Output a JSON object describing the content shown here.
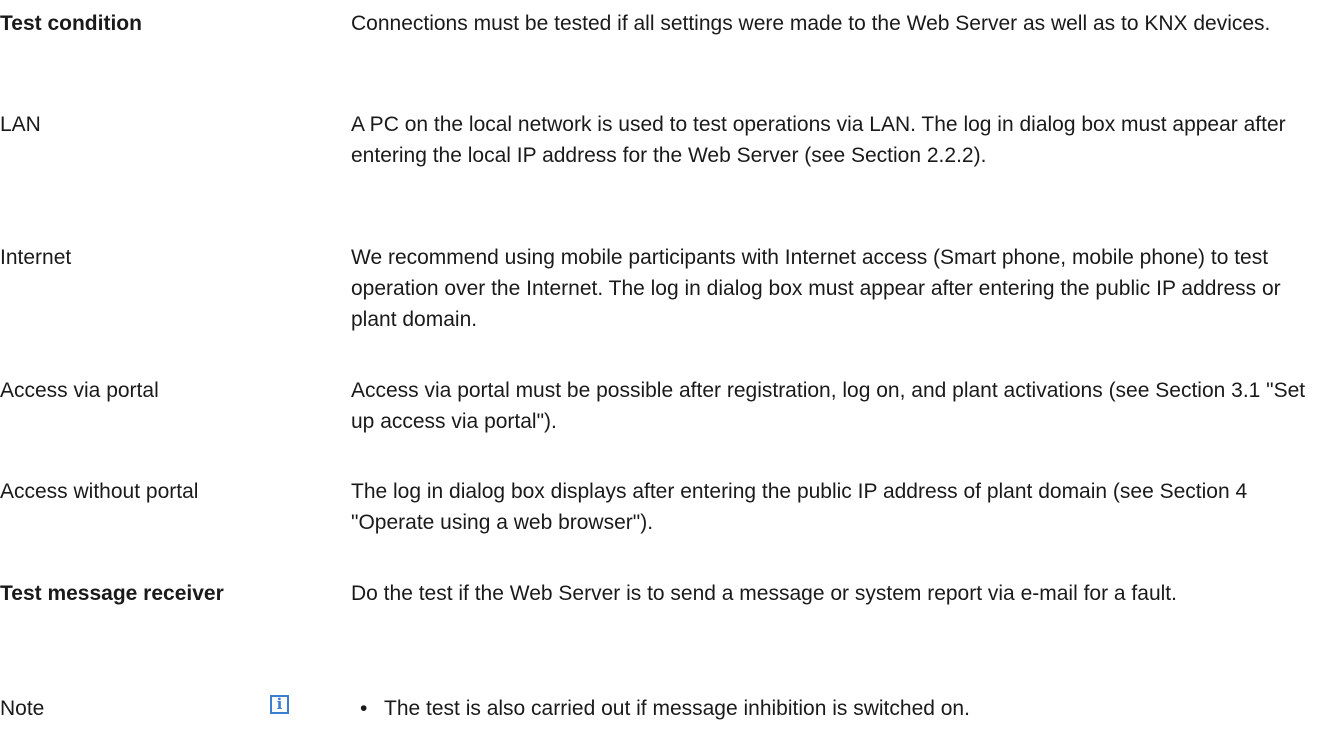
{
  "rows": [
    {
      "label": "Test condition",
      "text": "Connections must be tested if all settings were made to the Web Server as well as to KNX devices."
    },
    {
      "label": "LAN",
      "text": "A PC on the local network is used to test operations via LAN. The log in dialog box must appear after entering the local IP address for the Web Server (see Section 2.2.2)."
    },
    {
      "label": "Internet",
      "text": "We recommend using mobile participants with Internet access (Smart phone, mobile phone) to test operation over the Internet. The log in dialog box must appear after entering the public IP address or plant domain."
    },
    {
      "label": "Access via portal",
      "text": "Access via portal must be possible after registration, log on, and plant activations (see Section 3.1 \"Set up access via portal\")."
    },
    {
      "label": "Access without portal",
      "text": "The log in dialog box displays after entering the public IP address of plant domain (see Section 4 \"Operate using a web browser\")."
    },
    {
      "label": "Test message receiver",
      "text": "Do the test if the Web Server is to send a message or system report via e-mail for a fault."
    },
    {
      "label": "Note",
      "icon": "info-icon",
      "bullet": "The test is also carried out if message inhibition is switched on."
    }
  ]
}
